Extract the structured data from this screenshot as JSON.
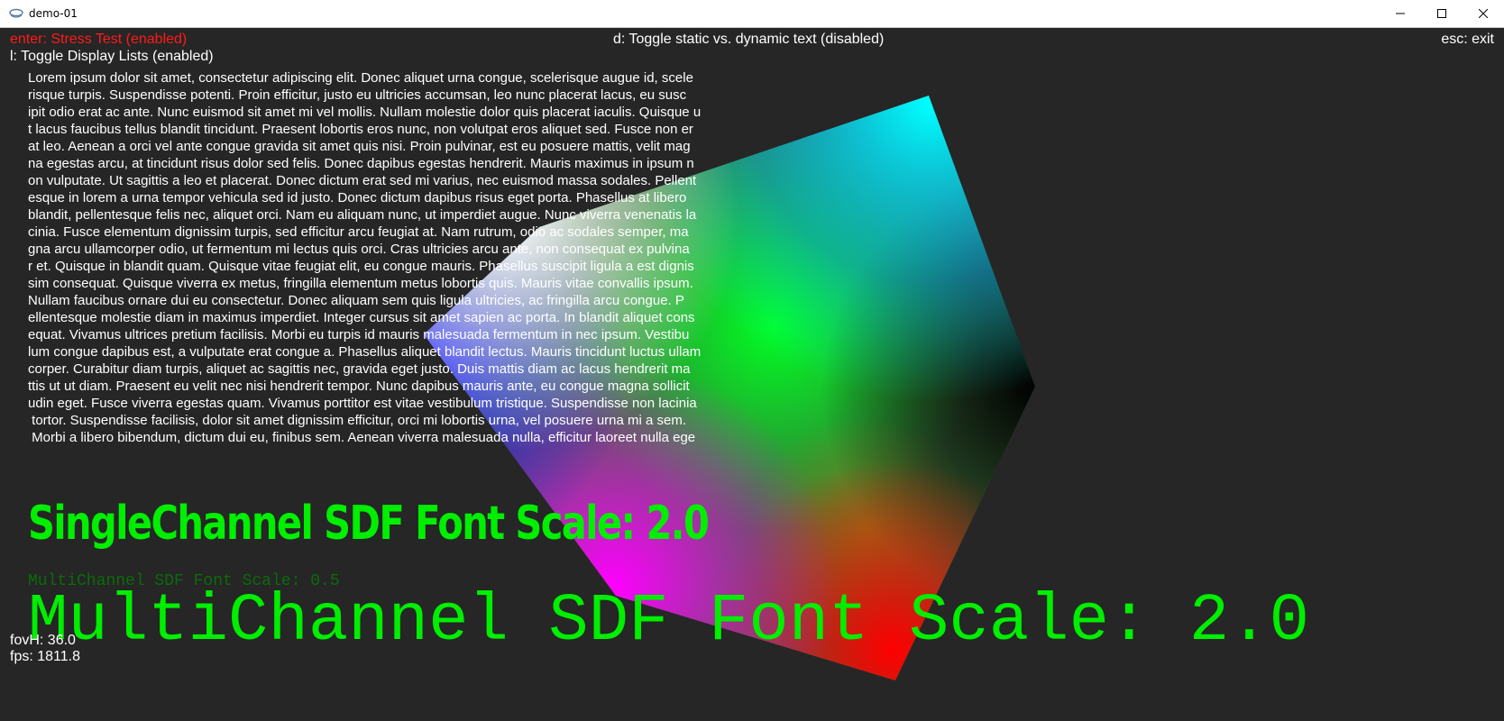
{
  "window": {
    "title": "demo-01"
  },
  "hud": {
    "stress_test": "enter: Stress Test (enabled)",
    "toggle_text": "d: Toggle static vs. dynamic text (disabled)",
    "exit": "esc: exit",
    "display_lists": "l: Toggle Display Lists (enabled)",
    "fov": "fovH: 36.0",
    "fps": "fps: 1811.8"
  },
  "lorem_lines": [
    "Lorem ipsum dolor sit amet, consectetur adipiscing elit. Donec aliquet urna congue, scelerisque augue id, scele",
    "risque turpis. Suspendisse potenti. Proin efficitur, justo eu ultricies accumsan, leo nunc placerat lacus, eu susc",
    "ipit odio erat ac ante. Nunc euismod sit amet mi vel mollis. Nullam molestie dolor quis placerat iaculis. Quisque u",
    "t lacus faucibus tellus blandit tincidunt. Praesent lobortis eros nunc, non volutpat eros aliquet sed. Fusce non er",
    "at leo. Aenean a orci vel ante congue gravida sit amet quis nisi. Proin pulvinar, est eu posuere mattis, velit mag",
    "na egestas arcu, at tincidunt risus dolor sed felis. Donec dapibus egestas hendrerit. Mauris maximus in ipsum n",
    "on vulputate. Ut sagittis a leo et placerat. Donec dictum erat sed mi varius, nec euismod massa sodales. Pellent",
    "esque in lorem a urna tempor vehicula sed id justo. Donec dictum dapibus risus eget porta. Phasellus at libero",
    "blandit, pellentesque felis nec, aliquet orci. Nam eu aliquam nunc, ut imperdiet augue. Nunc viverra venenatis la",
    "cinia. Fusce elementum dignissim turpis, sed efficitur arcu feugiat at. Nam rutrum, odio ac sodales semper, ma",
    "gna arcu ullamcorper odio, ut fermentum mi lectus quis orci. Cras ultricies arcu ante, non consequat ex pulvina",
    "r et. Quisque in blandit quam. Quisque vitae feugiat elit, eu congue mauris. Phasellus suscipit ligula a est dignis",
    "sim consequat. Quisque viverra ex metus, fringilla elementum metus lobortis quis. Mauris vitae convallis ipsum.",
    "Nullam faucibus ornare dui eu consectetur. Donec aliquam sem quis ligula ultricies, ac fringilla arcu congue. P",
    "ellentesque molestie diam in maximus imperdiet. Integer cursus sit amet sapien ac porta. In blandit aliquet cons",
    "equat. Vivamus ultrices pretium facilisis. Morbi eu turpis id mauris malesuada fermentum in nec ipsum. Vestibu",
    "lum congue dapibus est, a vulputate erat congue a. Phasellus aliquet blandit lectus. Mauris tincidunt luctus ullam",
    "corper. Curabitur diam turpis, aliquet ac sagittis nec, gravida eget justo. Duis mattis diam ac lacus hendrerit ma",
    "ttis ut ut diam. Praesent eu velit nec nisi hendrerit tempor. Nunc dapibus mauris ante, eu congue magna sollicit",
    "udin eget. Fusce viverra egestas quam. Vivamus porttitor est vitae vestibulum tristique. Suspendisse non lacinia",
    " tortor. Suspendisse facilisis, dolor sit amet dignissim efficitur, orci mi lobortis urna, vel posuere urna mi a sem.",
    " Morbi a libero bibendum, dictum dui eu, finibus sem. Aenean viverra malesuada nulla, efficitur laoreet nulla ege"
  ],
  "sdf": {
    "single_channel": "SingleChannel SDF Font Scale: 2.0",
    "multi_channel_small": "MultiChannel SDF Font Scale: 0.5",
    "multi_channel_big": "MultiChannel SDF Font Scale: 2.0"
  },
  "colors": {
    "background": "#262626",
    "hud_red": "#ff1a1a",
    "sdf_green": "#00ee00",
    "dim_green": "#0b6b0b"
  },
  "icons": {
    "minimize": "minimize-icon",
    "maximize": "maximize-icon",
    "close": "close-icon"
  }
}
